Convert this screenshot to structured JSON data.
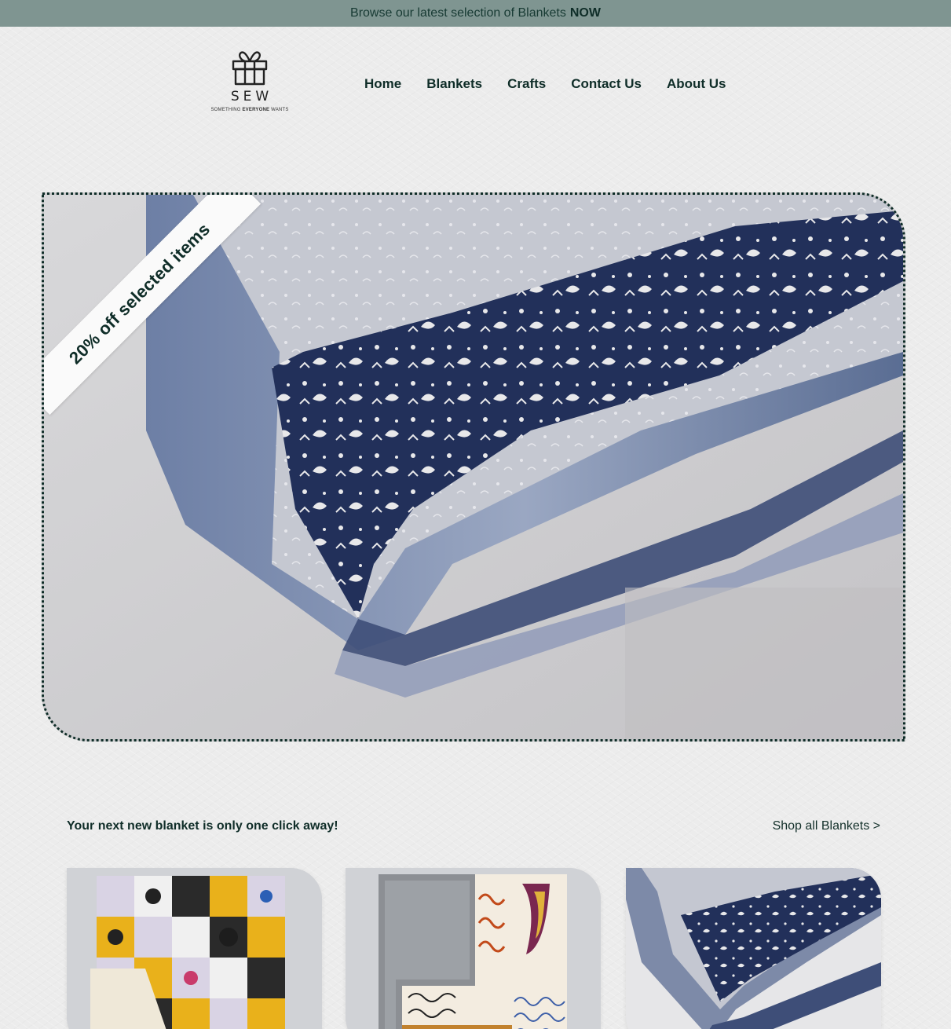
{
  "announcement": {
    "text": "Browse our latest selection of Blankets",
    "emphasis": "NOW"
  },
  "brand": {
    "name": "SEW",
    "tagline_pre": "SOMETHING ",
    "tagline_bold": "EVERYONE",
    "tagline_post": " WANTS",
    "icon": "gift-icon"
  },
  "nav": {
    "items": [
      {
        "label": "Home"
      },
      {
        "label": "Blankets"
      },
      {
        "label": "Crafts"
      },
      {
        "label": "Contact Us"
      },
      {
        "label": "About Us"
      }
    ]
  },
  "hero": {
    "ribbon": "20% off selected items"
  },
  "blankets": {
    "heading": "Your next new blanket is only one click away!",
    "shop_all": "Shop all Blankets >"
  },
  "colors": {
    "announce_bg": "#7f9591",
    "brand_dark": "#0f2d28",
    "page_bg": "#ececec"
  }
}
